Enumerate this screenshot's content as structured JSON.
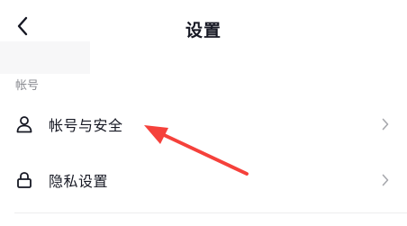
{
  "header": {
    "title": "设置",
    "back_icon": "chevron-left-icon"
  },
  "section": {
    "label": "帐号"
  },
  "rows": [
    {
      "label": "帐号与安全",
      "icon": "user-icon",
      "trailing_icon": "chevron-right-icon"
    },
    {
      "label": "隐私设置",
      "icon": "lock-icon",
      "trailing_icon": "chevron-right-icon"
    }
  ],
  "colors": {
    "annotation": "#f5413b",
    "text": "#161823",
    "secondary_text": "#8a8b91",
    "chevron": "#a7a8ad"
  }
}
